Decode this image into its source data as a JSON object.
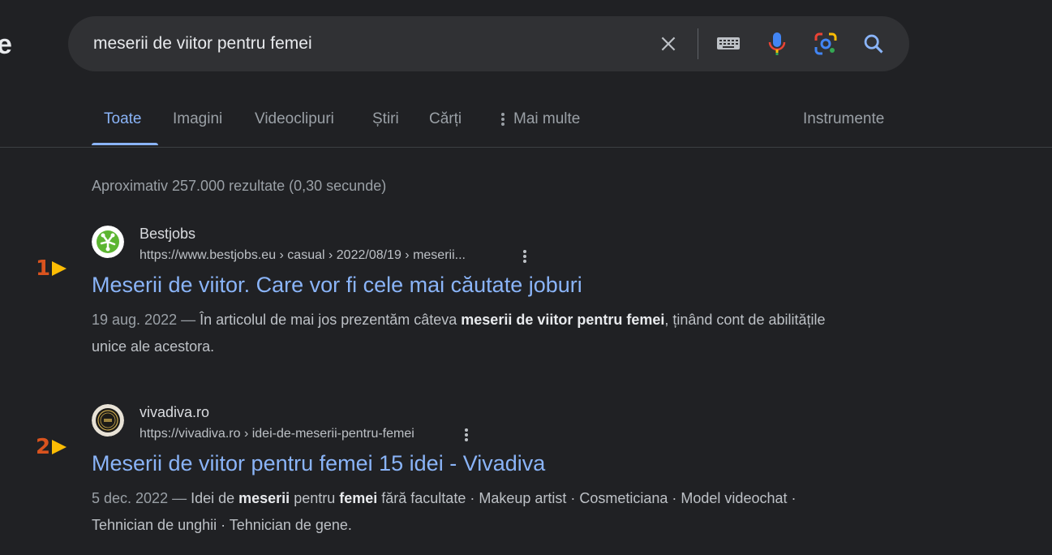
{
  "search": {
    "query": "meserii de viitor pentru femei"
  },
  "tabs": [
    "Toate",
    "Imagini",
    "Videoclipuri",
    "Știri",
    "Cărți",
    "Mai multe"
  ],
  "tools_label": "Instrumente",
  "stats": "Aproximativ 257.000 rezultate (0,30 secunde)",
  "results": [
    {
      "marker": "1",
      "site": "Bestjobs",
      "url": "https://www.bestjobs.eu › casual › 2022/08/19 › meserii...",
      "title": "Meserii de viitor. Care vor fi cele mai căutate joburi",
      "date": "19 aug. 2022",
      "dash": " — ",
      "snippet_parts": [
        "În articolul de mai jos prezentăm câteva ",
        "meserii de viitor pentru femei",
        ", ținând cont de abilitățile unice ale acestora."
      ]
    },
    {
      "marker": "2",
      "site": "vivadiva.ro",
      "url": "https://vivadiva.ro › idei-de-meserii-pentru-femei",
      "title": "Meserii de viitor pentru femei 15 idei - Vivadiva",
      "date": "5 dec. 2022",
      "dash": " — ",
      "snippet_parts": [
        "Idei de ",
        "meserii",
        " pentru ",
        "femei",
        " fără facultate · Makeup artist · Cosmeticiana · Model videochat · Tehnician de unghii · Tehnician de gene."
      ]
    }
  ],
  "colors": {
    "background": "#202124",
    "link": "#8ab4f8",
    "marker_number": "#d9531e",
    "marker_arrow": "#fbbc04"
  },
  "icons": [
    "clear-icon",
    "keyboard-icon",
    "microphone-icon",
    "google-lens-icon",
    "search-icon",
    "more-vert-icon"
  ]
}
